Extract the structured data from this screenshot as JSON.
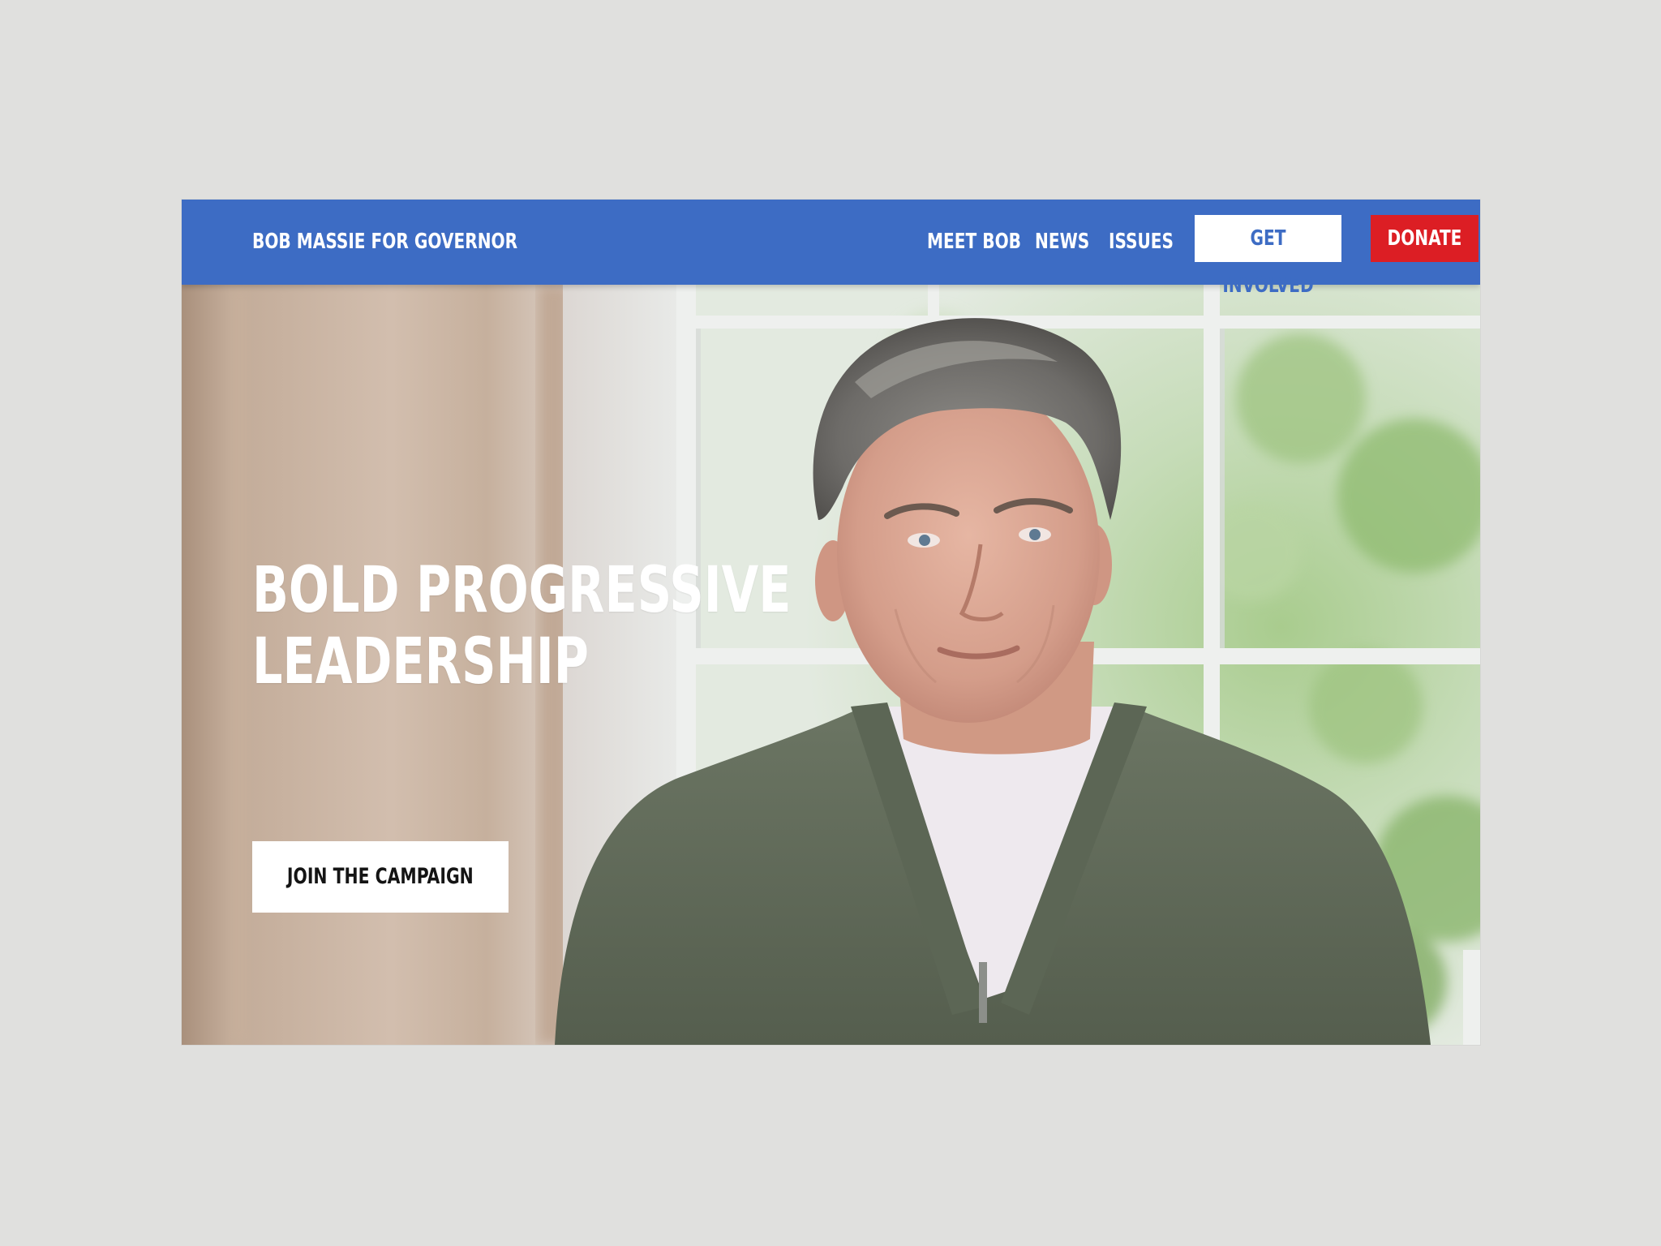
{
  "brand": "BOB MASSIE FOR GOVERNOR",
  "nav": {
    "links": [
      "MEET BOB",
      "NEWS",
      "ISSUES"
    ],
    "get_involved": "GET INVOLVED",
    "donate": "DONATE"
  },
  "hero": {
    "headline_line1": "BOLD PROGRESSIVE",
    "headline_line2": "LEADERSHIP",
    "cta": "JOIN THE CAMPAIGN",
    "image": "candidate-portrait-photo"
  },
  "colors": {
    "nav_background": "#3d6cc4",
    "donate_background": "#dc1e24",
    "page_background": "#e0e0de"
  }
}
